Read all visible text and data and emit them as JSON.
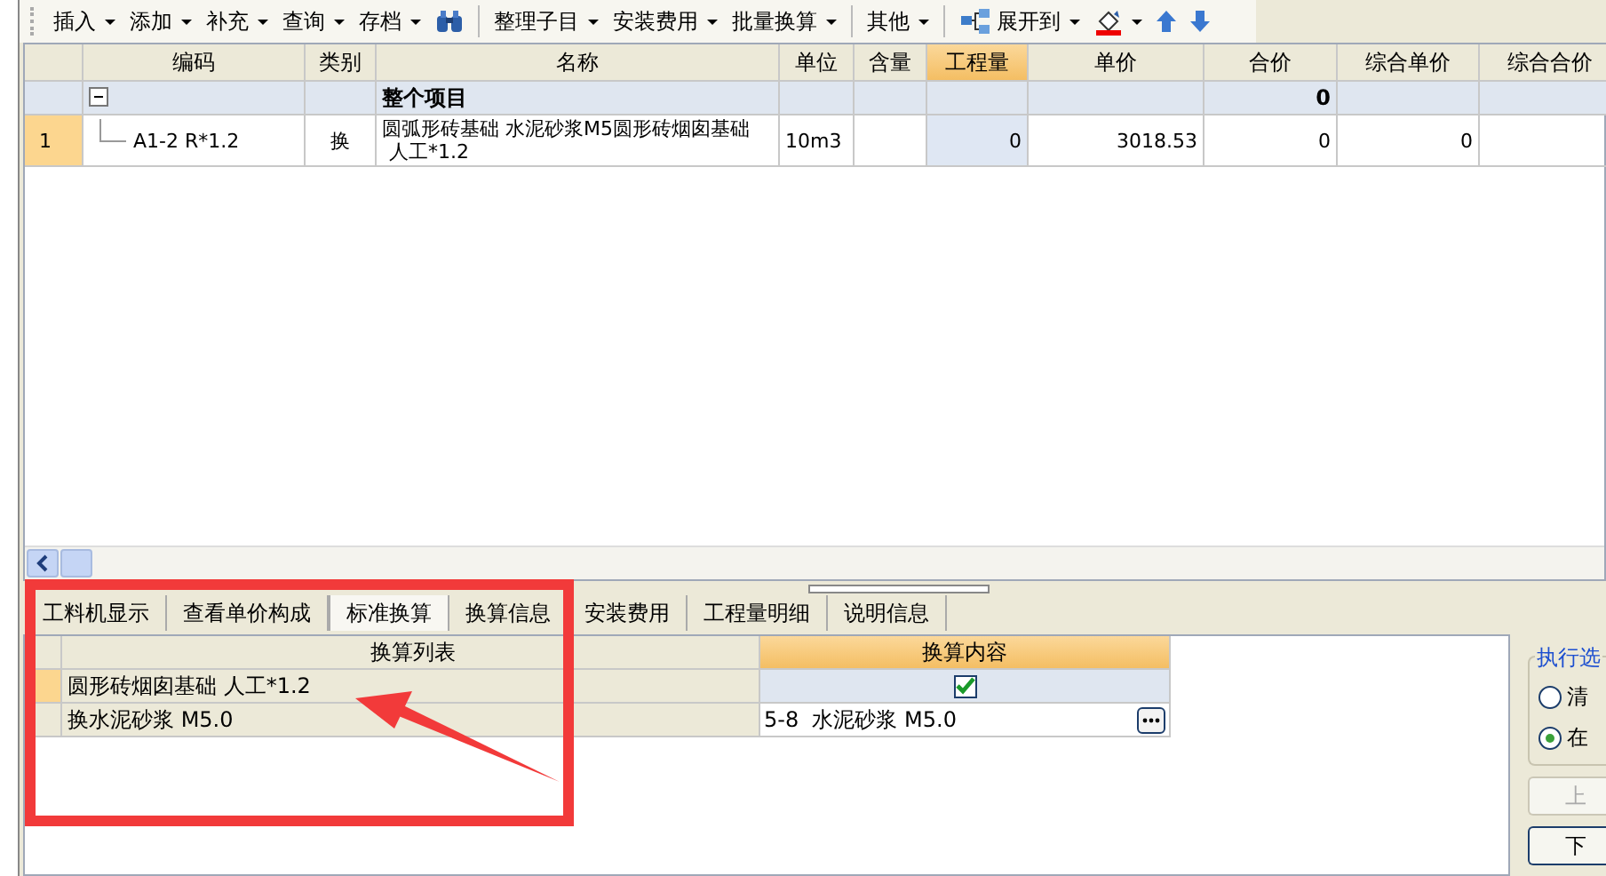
{
  "toolbar": [
    {
      "kind": "text",
      "label": "插入",
      "dropdown": true
    },
    {
      "kind": "text",
      "label": "添加",
      "dropdown": true
    },
    {
      "kind": "text",
      "label": "补充",
      "dropdown": true
    },
    {
      "kind": "text",
      "label": "查询",
      "dropdown": true
    },
    {
      "kind": "text",
      "label": "存档",
      "dropdown": true
    },
    {
      "kind": "find",
      "dropdown": false
    },
    {
      "kind": "separator"
    },
    {
      "kind": "text",
      "label": "整理子目",
      "dropdown": true
    },
    {
      "kind": "text",
      "label": "安装费用",
      "dropdown": true
    },
    {
      "kind": "text",
      "label": "批量换算",
      "dropdown": true
    },
    {
      "kind": "separator"
    },
    {
      "kind": "text",
      "label": "其他",
      "dropdown": true
    },
    {
      "kind": "separator"
    },
    {
      "kind": "tree",
      "label": "展开到",
      "dropdown": true
    },
    {
      "kind": "fill",
      "dropdown": true
    },
    {
      "kind": "up",
      "dropdown": false
    },
    {
      "kind": "down",
      "dropdown": false
    }
  ],
  "table": {
    "columns": [
      {
        "label": "编码",
        "selected": false
      },
      {
        "label": "类别",
        "selected": false
      },
      {
        "label": "名称",
        "selected": false
      },
      {
        "label": "单位",
        "selected": false
      },
      {
        "label": "含量",
        "selected": false
      },
      {
        "label": "工程量",
        "selected": true
      },
      {
        "label": "单价",
        "selected": false
      },
      {
        "label": "合价",
        "selected": false
      },
      {
        "label": "综合单价",
        "selected": false
      },
      {
        "label": "综合合价",
        "selected": false
      }
    ],
    "rows": [
      {
        "kind": "group",
        "expanded": true,
        "name": "整个项目",
        "total": "0"
      },
      {
        "kind": "item",
        "selected": true,
        "index": "1",
        "code": "A1-2 R*1.2",
        "type": "换",
        "name": [
          "圆弧形砖基础 水泥砂浆M5圆形砖烟囱基础",
          "人工*1.2"
        ],
        "unit": "10m3",
        "quantity": "0",
        "price": "3018.53",
        "total": "0",
        "comp_price": "0"
      }
    ]
  },
  "tabs": [
    {
      "label": "工料机显示",
      "selected": false
    },
    {
      "label": "查看单价构成",
      "selected": false
    },
    {
      "label": "标准换算",
      "selected": true
    },
    {
      "label": "换算信息",
      "selected": false
    },
    {
      "label": "安装费用",
      "selected": false
    },
    {
      "label": "工程量明细",
      "selected": false
    },
    {
      "label": "说明信息",
      "selected": false
    }
  ],
  "conversion": {
    "columns": [
      "换算列表",
      "换算内容"
    ],
    "rows": [
      {
        "kind": "checkbox",
        "item": "圆形砖烟囱基础 人工*1.2",
        "checked": true,
        "selected": true
      },
      {
        "kind": "lookup",
        "item": "换水泥砂浆 M5.0",
        "value": "5-8  水泥砂浆 M5.0",
        "selected": false
      }
    ]
  },
  "options": {
    "title": "执行选",
    "radios": [
      {
        "label": "清",
        "selected": false
      },
      {
        "label": "在",
        "selected": true
      }
    ],
    "buttons": [
      {
        "label": "上",
        "disabled": true
      },
      {
        "label": "下",
        "disabled": false
      }
    ]
  }
}
